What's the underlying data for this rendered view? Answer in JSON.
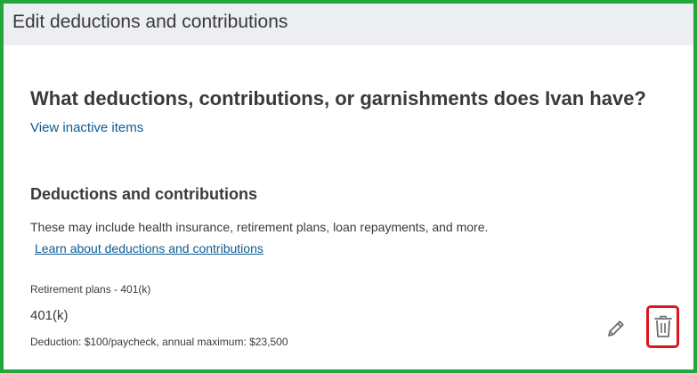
{
  "header": {
    "title": "Edit deductions and contributions"
  },
  "main": {
    "question": "What deductions, contributions, or garnishments does Ivan have?",
    "view_inactive_link": "View inactive items",
    "section": {
      "title": "Deductions and contributions",
      "description": "These may include health insurance, retirement plans, loan repayments, and more.",
      "learn_link": "Learn about deductions and contributions"
    },
    "items": [
      {
        "category": "Retirement plans - 401(k)",
        "name": "401(k)",
        "detail": "Deduction: $100/paycheck, annual maximum: $23,500",
        "actions": {
          "edit_icon": "pencil-icon",
          "delete_icon": "trash-icon"
        }
      }
    ]
  },
  "colors": {
    "frame_border": "#22a63d",
    "header_bg": "#eceef1",
    "link": "#0d5b91",
    "text": "#393a3d",
    "highlight_border": "#e0141e"
  }
}
